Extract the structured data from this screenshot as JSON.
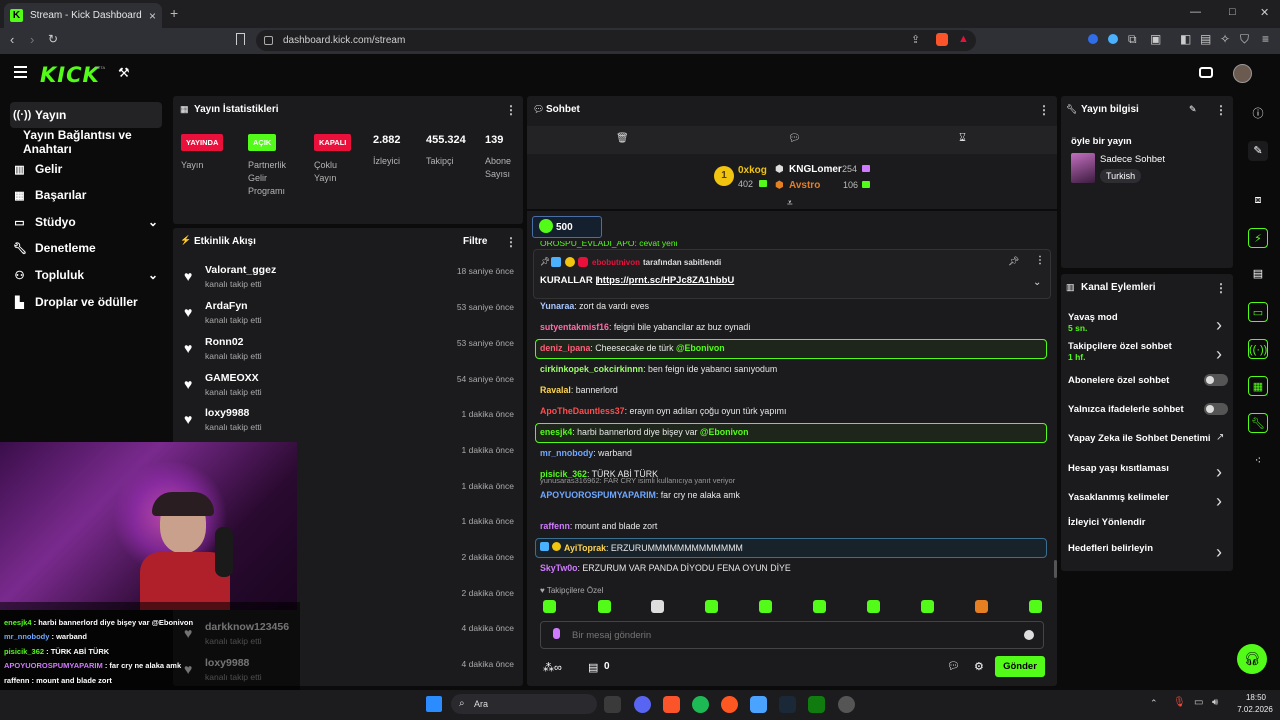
{
  "browser": {
    "tab_title": "Stream - Kick Dashboard",
    "new_tab": "+",
    "url": "dashboard.kick.com/stream",
    "window_controls": [
      "—",
      "□",
      "✕"
    ]
  },
  "header": {
    "logo": "KICK",
    "beta": "BETA"
  },
  "sidebar": {
    "items": [
      {
        "label": "Yayın",
        "icon": "broadcast-icon"
      },
      {
        "label": "Yayın Bağlantısı ve Anahtarı"
      },
      {
        "label": "Gelir",
        "icon": "chart-icon"
      },
      {
        "label": "Başarılar",
        "icon": "trophy-icon"
      },
      {
        "label": "Stüdyo",
        "icon": "studio-icon"
      },
      {
        "label": "Denetleme",
        "icon": "wrench-icon"
      },
      {
        "label": "Topluluk",
        "icon": "people-icon"
      },
      {
        "label": "Droplar ve ödüller",
        "icon": "gift-icon"
      }
    ]
  },
  "stats": {
    "title": "Yayın İstatistikleri",
    "items": [
      {
        "badge": "YAYINDA",
        "badge_color": "#e9113c",
        "label": "Yayın"
      },
      {
        "badge": "AÇIK",
        "badge_color": "#53fc18",
        "label": "Partnerlik Gelir Programı"
      },
      {
        "badge": "KAPALI",
        "badge_color": "#e9113c",
        "label": "Çoklu Yayın"
      },
      {
        "value": "2.882",
        "label": "İzleyici"
      },
      {
        "value": "455.324",
        "label": "Takipçi"
      },
      {
        "value": "139",
        "label": "Abone Sayısı"
      }
    ]
  },
  "activity": {
    "title": "Etkinlik Akışı",
    "filter": "Filtre",
    "events": [
      {
        "name": "Valorant_ggez",
        "sub": "kanalı takip etti",
        "time": "18 saniye önce"
      },
      {
        "name": "ArdaFyn",
        "sub": "kanalı takip etti",
        "time": "53 saniye önce"
      },
      {
        "name": "Ronn02",
        "sub": "kanalı takip etti",
        "time": "53 saniye önce"
      },
      {
        "name": "GAMEOXX",
        "sub": "kanalı takip etti",
        "time": "54 saniye önce"
      },
      {
        "name": "loxy9988",
        "sub": "kanalı takip etti",
        "time": "1 dakika önce"
      },
      {
        "name": "",
        "sub": "",
        "time": "1 dakika önce"
      },
      {
        "name": "",
        "sub": "",
        "time": "1 dakika önce"
      },
      {
        "name": "",
        "sub": "",
        "time": "1 dakika önce"
      },
      {
        "name": "",
        "sub": "",
        "time": "2 dakika önce"
      },
      {
        "name": "",
        "sub": "",
        "time": "2 dakika önce"
      },
      {
        "name": "darkknow123456",
        "sub": "kanalı takip etti",
        "time": "4 dakika önce"
      },
      {
        "name": "loxy9988",
        "sub": "kanalı takip etti",
        "time": "4 dakika önce"
      }
    ]
  },
  "chat": {
    "title": "Sohbet",
    "leaders": [
      {
        "rank": "1",
        "name": "0xkog",
        "value": "402"
      },
      {
        "name": "KNGLomer",
        "value": "254"
      },
      {
        "name": "Avstro",
        "value": "106"
      }
    ],
    "goal": "500",
    "cut_line": "OROSPU_EVLADI_APO: cevat yeni",
    "pinned_by": "ebobutnivon",
    "pinned_suffix": "tarafından sabitlendi",
    "pinned_text": "KURALLAR |",
    "pinned_link": "https://prnt.sc/HPJc8ZA1hbbU",
    "messages": [
      {
        "user": "Yunaraa",
        "color": "#a9c8ff",
        "text": ": zort da vardı eves"
      },
      {
        "user": "sutyentakmisf16",
        "color": "#ff6ea8",
        "text": ": feigni bile yabancilar az buz oynadi"
      },
      {
        "user": "deniz_ipana",
        "color": "#ff5e7a",
        "text": ": Cheesecake de türk ",
        "mention": "@Ebonivon",
        "hl": true
      },
      {
        "user": "cirkinkopek_cokcirkinnn",
        "color": "#9dff6b",
        "text": ": ben feign ide yabancı sanıyodum"
      },
      {
        "user": "Ravalal",
        "color": "#ffd54f",
        "text": ": bannerlord"
      },
      {
        "user": "ApoTheDauntless37",
        "color": "#ff4d4d",
        "text": ": erayın oyn adıları çoğu oyun türk yapımı"
      },
      {
        "user": "enesjk4",
        "color": "#53fc18",
        "text": ": harbi bannerlord diye bişey var ",
        "mention": "@Ebonivon",
        "hl": true
      },
      {
        "user": "mr_nnobody",
        "color": "#6fa8ff",
        "text": ": warband"
      },
      {
        "user": "pisicik_362",
        "color": "#53fc18",
        "text": ": TÜRK ABİ TÜRK"
      },
      {
        "reply": "yunusaras316962: FAR CRY isimli kullanıcıya yanıt veriyor",
        "user": "APOYUOROSPUMYAPARIM",
        "color": "#6fa8ff",
        "text": ": far cry ne alaka amk"
      },
      {
        "user": "raffenn",
        "color": "#d07bff",
        "text": ": mount and blade zort"
      },
      {
        "user": "AyiToprak",
        "color": "#ffd54f",
        "text": ": ERZURUMMMMMMMMMMMMM",
        "hl2": true
      },
      {
        "user": "SkyTw0o",
        "color": "#d07bff",
        "text": ": ERZURUM VAR PANDA DİYODU FENA OYUN DİYE"
      }
    ],
    "followers_only": "Takipçilere Özel",
    "input_placeholder": "Bir mesaj gönderin",
    "points": "0",
    "send": "Gönder"
  },
  "info": {
    "title": "Yayın bilgisi",
    "stream_title": "öyle bir yayın",
    "category": "Sadece Sohbet",
    "tag": "Turkish"
  },
  "actions": {
    "title": "Kanal Eylemleri",
    "items": [
      {
        "label": "Yavaş mod",
        "sub": "5 sn.",
        "ctrl": "chevron"
      },
      {
        "label": "Takipçilere özel sohbet",
        "sub": "1 hf.",
        "ctrl": "chevron"
      },
      {
        "label": "Abonelere özel sohbet",
        "ctrl": "toggle"
      },
      {
        "label": "Yalnızca ifadelerle sohbet",
        "ctrl": "toggle"
      },
      {
        "label": "Yapay Zeka ile Sohbet Denetimi",
        "ctrl": "external"
      },
      {
        "label": "Hesap yaşı kısıtlaması",
        "ctrl": "chevron"
      },
      {
        "label": "Yasaklanmış kelimeler",
        "ctrl": "chevron"
      },
      {
        "label": "İzleyici Yönlendir",
        "ctrl": "none"
      },
      {
        "label": "Hedefleri belirleyin",
        "ctrl": "chevron"
      }
    ]
  },
  "overlay_chat": [
    {
      "user": "enesjk4",
      "color": "#53fc18",
      "text": " : harbi bannerlord diye bişey var @Ebonivon"
    },
    {
      "user": "mr_nnobody",
      "color": "#6fa8ff",
      "text": " : warband"
    },
    {
      "user": "pisicik_362",
      "color": "#53fc18",
      "text": " : TÜRK ABİ TÜRK"
    },
    {
      "user": "APOYUOROSPUMYAPARIM",
      "color": "#d07bff",
      "text": " : far cry ne alaka amk"
    },
    {
      "user": "raffenn",
      "color": "#ffffff",
      "text": " : mount and blade zort"
    },
    {
      "user": "AyiToprak",
      "color": "#ffd54f",
      "text": " : ERZURUMMMMMMMMMMMMM"
    },
    {
      "user": "SkyTw0o",
      "color": "#d07bff",
      "text": " : ERZURUM VAR PANDA DİYODU FENA OYUN DİYE"
    }
  ],
  "taskbar": {
    "search": "Ara",
    "time": "18:50",
    "date": "7.02.2026"
  }
}
